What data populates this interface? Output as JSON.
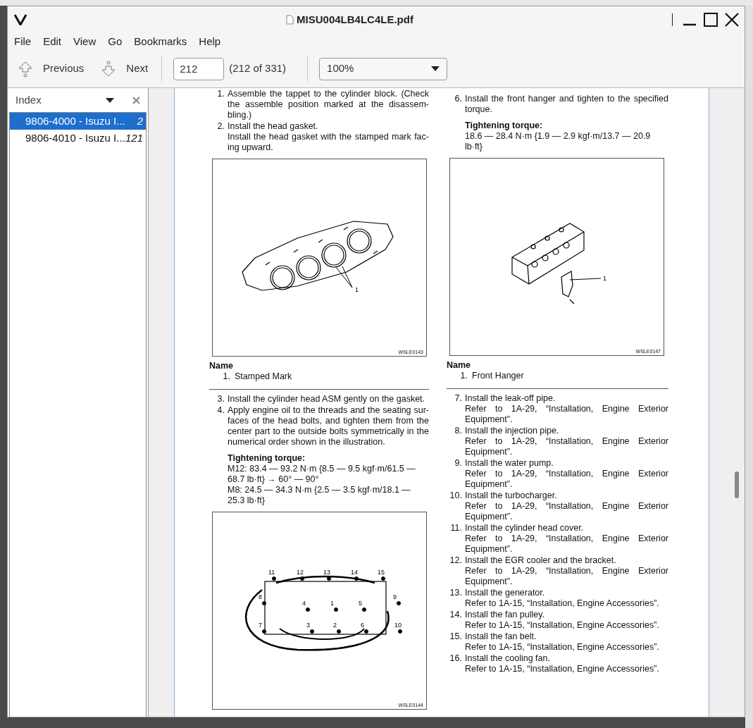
{
  "window": {
    "title": "MISU004LB4LC4LE.pdf"
  },
  "menu": [
    "File",
    "Edit",
    "View",
    "Go",
    "Bookmarks",
    "Help"
  ],
  "toolbar": {
    "previous": "Previous",
    "next": "Next",
    "page_field": "212",
    "page_count": "(212 of 331)",
    "zoom": "100%"
  },
  "sidebar": {
    "title": "Index",
    "items": [
      {
        "label": "9806-4000 - Isuzu I...",
        "page": "2",
        "selected": true
      },
      {
        "label": "9806-4010 - Isuzu I...",
        "page": "121",
        "selected": false
      }
    ]
  },
  "document": {
    "left_column": [
      {
        "kind": "step",
        "number": "1.",
        "text": [
          "Assemble the tappet to the cylinder block. (Check",
          "the assemble position marked at the disassem-",
          "bling.)"
        ]
      },
      {
        "kind": "step",
        "number": "2.",
        "text": [
          "Install the head gasket."
        ],
        "note": [
          "Install the head gasket with the stamped mark fac-",
          "ing upward."
        ]
      },
      {
        "kind": "figure_gasket",
        "callouts": [
          "1"
        ],
        "code": "WSLE0143"
      },
      {
        "kind": "names",
        "heading": "Name",
        "items": [
          {
            "number": "1.",
            "label": "Stamped Mark"
          }
        ]
      },
      {
        "kind": "step",
        "number": "3.",
        "text": [
          "Install the cylinder head ASM gently on the gasket."
        ]
      },
      {
        "kind": "step",
        "number": "4.",
        "text": [
          "Apply engine oil to the threads and the seating sur-",
          "faces of the head bolts, and tighten them from the",
          "center part to the outside bolts symmetrically in the",
          "numerical order shown in the illustration."
        ]
      },
      {
        "kind": "torque",
        "heading": "Tightening torque:",
        "lines": [
          "M12: 83.4 — 93.2 N·m {8.5 — 9.5 kgf·m/61.5 —",
          "68.7 lb·ft} → 60° — 90°",
          "M8: 24.5 — 34.3 N·m {2.5 — 3.5 kgf·m/18.1 —",
          "25.3 lb·ft}"
        ]
      },
      {
        "kind": "figure_bolt_sequence",
        "callouts": [
          "11",
          "12",
          "13",
          "14",
          "15",
          "8",
          "4",
          "1",
          "5",
          "9",
          "7",
          "3",
          "2",
          "6",
          "10"
        ],
        "code": "WSLE0144"
      }
    ],
    "right_column": [
      {
        "kind": "step",
        "number": "6.",
        "text": [
          "Install the front hanger and tighten to the specified",
          "torque."
        ]
      },
      {
        "kind": "torque",
        "heading": "Tightening torque:",
        "lines": [
          "18.6 — 28.4 N·m {1.9 — 2.9 kgf·m/13.7 — 20.9",
          "lb·ft}"
        ]
      },
      {
        "kind": "figure_cylinder_head",
        "callouts": [
          "1"
        ],
        "code": "WSLE0147"
      },
      {
        "kind": "names",
        "heading": "Name",
        "items": [
          {
            "number": "1.",
            "label": "Front Hanger"
          }
        ]
      },
      {
        "kind": "step",
        "number": "7.",
        "text": [
          "Install the leak-off pipe."
        ],
        "note": [
          "Refer to 1A-29, “Installation, Engine Exterior",
          "Equipment”."
        ]
      },
      {
        "kind": "step",
        "number": "8.",
        "text": [
          "Install the injection pipe."
        ],
        "note": [
          "Refer to 1A-29, “Installation, Engine Exterior",
          "Equipment”."
        ]
      },
      {
        "kind": "step",
        "number": "9.",
        "text": [
          "Install the water pump."
        ],
        "note": [
          "Refer to 1A-29, “Installation, Engine Exterior",
          "Equipment”."
        ]
      },
      {
        "kind": "step",
        "number": "10.",
        "text": [
          "Install the turbocharger."
        ],
        "note": [
          "Refer to 1A-29, “Installation, Engine Exterior",
          "Equipment”."
        ]
      },
      {
        "kind": "step",
        "number": "11.",
        "text": [
          "Install the cylinder head cover."
        ],
        "note": [
          "Refer to 1A-29, “Installation, Engine Exterior",
          "Equipment”."
        ]
      },
      {
        "kind": "step",
        "number": "12.",
        "text": [
          "Install the EGR cooler and the bracket."
        ],
        "note": [
          "Refer to 1A-29, “Installation, Engine Exterior",
          "Equipment”."
        ]
      },
      {
        "kind": "step",
        "number": "13.",
        "text": [
          "Install the generator."
        ],
        "note": [
          "Refer to 1A-15, “Installation, Engine Accessories”."
        ]
      },
      {
        "kind": "step",
        "number": "14.",
        "text": [
          "Install the fan pulley."
        ],
        "note": [
          "Refer to 1A-15, “Installation, Engine Accessories”."
        ]
      },
      {
        "kind": "step",
        "number": "15.",
        "text": [
          "Install the fan belt."
        ],
        "note": [
          "Refer to 1A-15, “Installation, Engine Accessories”."
        ]
      },
      {
        "kind": "step",
        "number": "16.",
        "text": [
          "Install the cooling fan."
        ],
        "note": [
          "Refer to 1A-15, “Installation, Engine Accessories”."
        ]
      }
    ]
  }
}
